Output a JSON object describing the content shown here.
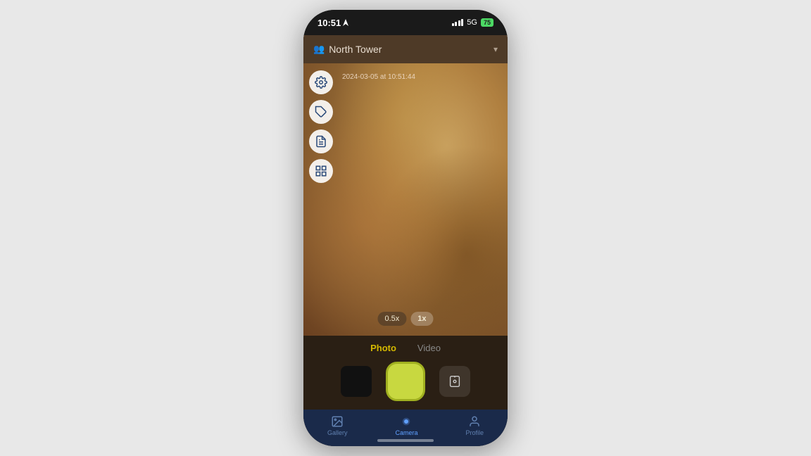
{
  "status": {
    "time": "10:51",
    "signal_label": "5G",
    "battery_percent": "75"
  },
  "location_bar": {
    "icon": "👥",
    "name": "North Tower",
    "chevron": "▾"
  },
  "camera": {
    "timestamp": "2024-03-05 at 10:51:44"
  },
  "zoom": {
    "options": [
      "0.5x",
      "1x"
    ],
    "active": "1x"
  },
  "modes": {
    "tabs": [
      "Photo",
      "Video"
    ],
    "active": "Photo"
  },
  "nav": {
    "items": [
      {
        "id": "gallery",
        "label": "Gallery",
        "icon": "🖼"
      },
      {
        "id": "camera",
        "label": "Camera",
        "icon": "⏺"
      },
      {
        "id": "profile",
        "label": "Profile",
        "icon": "👤"
      }
    ],
    "active": "camera"
  },
  "icons": {
    "settings": "⚙",
    "tag": "🏷",
    "document": "📄",
    "grid": "⊞"
  }
}
